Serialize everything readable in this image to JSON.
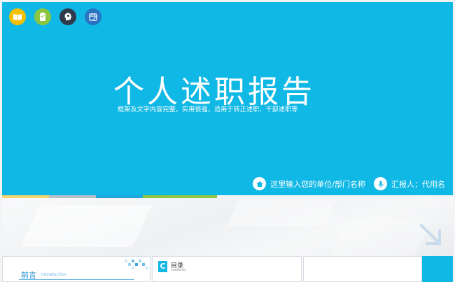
{
  "slide": {
    "title": "个人述职报告",
    "subtitle": "框架及文字内容完整，实用很强，适用于转正述职、干部述职等",
    "unit": "这里输入您的单位/部门名称",
    "reporter": "汇报人：代用名"
  },
  "top_icons": [
    {
      "name": "book-icon",
      "color": "#f6c000"
    },
    {
      "name": "clipboard-icon",
      "color": "#8cc63e"
    },
    {
      "name": "head-icon",
      "color": "#2f3a4a"
    },
    {
      "name": "calendar-icon",
      "color": "#2a74c4"
    }
  ],
  "stripe_colors": [
    "#f5d76e",
    "#b7c0c8",
    "#1ea7de",
    "#8ec63f"
  ],
  "thumb1": {
    "title": "前言",
    "subtitle": "Introduction"
  },
  "thumb2": {
    "letter": "C",
    "title": "目录",
    "subtitle": "contents"
  },
  "colors": {
    "accent": "#10b8e5"
  }
}
